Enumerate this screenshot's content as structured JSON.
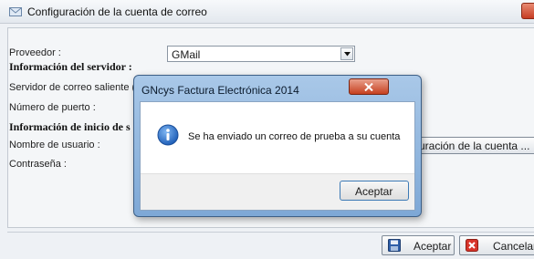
{
  "window": {
    "title": "Configuración de la cuenta de correo"
  },
  "form": {
    "provider_label": "Proveedor :",
    "provider_value": "GMail",
    "server_section": "Información del servidor :",
    "smtp_label": "Servidor de correo saliente (S",
    "port_label": "Número de puerto :",
    "login_section": "Información de inicio de s",
    "username_label": "Nombre de usuario :",
    "password_label": "Contraseña :",
    "config_button": "uración de la cuenta ..."
  },
  "footer": {
    "accept_label": "Aceptar",
    "cancel_label": "Cancelar"
  },
  "dialog": {
    "title": "GNcys Factura Electrónica 2014",
    "message": "Se ha enviado un correo de prueba a su cuenta",
    "ok_label": "Aceptar",
    "icon": "info-icon"
  },
  "colors": {
    "dialog_frame": "#7ea8d6",
    "close_red": "#c6401f",
    "info_blue": "#2a6fcf"
  }
}
